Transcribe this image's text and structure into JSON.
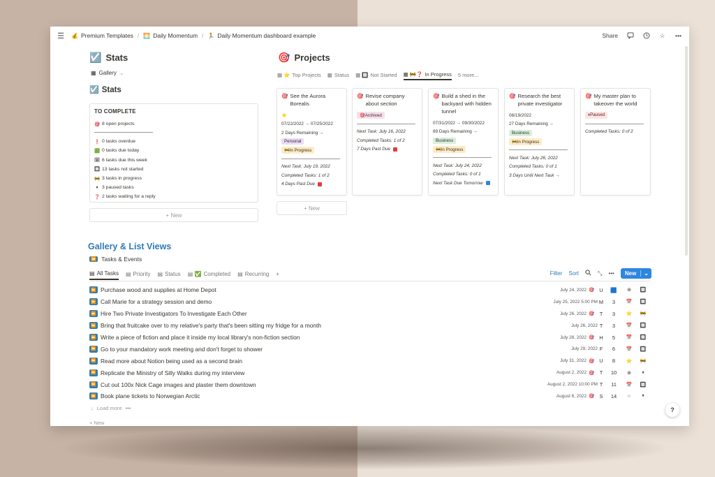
{
  "topbar": {
    "breadcrumbs": [
      {
        "icon": "💰",
        "label": "Premium Templates"
      },
      {
        "icon": "🌅",
        "label": "Daily Momentum"
      },
      {
        "icon": "🏃",
        "label": "Daily Momentum dashboard example"
      }
    ],
    "share_label": "Share"
  },
  "stats": {
    "title": "Stats",
    "view_label": "Gallery",
    "subtitle": "Stats",
    "box_title": "TO COMPLETE",
    "open_projects": "8 open projects",
    "lines": [
      {
        "icon": "❗",
        "text": "0 tasks overdue"
      },
      {
        "icon": "🟩",
        "text": "0 tasks due today"
      },
      {
        "icon": "🗓",
        "text": "6 tasks due this week"
      },
      {
        "icon": "🔲",
        "text": "13 tasks not started"
      },
      {
        "icon": "🚧",
        "text": "3 tasks in progress"
      },
      {
        "icon": "⏸",
        "text": "3 paused tasks"
      },
      {
        "icon": "❓",
        "text": "2 tasks waiting for a reply"
      }
    ],
    "new_label": "New"
  },
  "projects": {
    "title": "Projects",
    "tabs": [
      {
        "icon": "⭐",
        "label": "Top Projects"
      },
      {
        "icon": "▦",
        "label": "Status"
      },
      {
        "icon": "▦",
        "label": "Not Started"
      },
      {
        "icon": "❓",
        "label": "In Progress"
      }
    ],
    "more_label": "5 more...",
    "new_label": "New",
    "cards": [
      {
        "title": "See the Aurora Borealis",
        "star": "⭐",
        "dates": "07/22/2022 → 07/25/2022",
        "remaining": "2 Days Remaining →",
        "tag1": "Personal",
        "tag2": "🚧In Progress",
        "next_task": "Next Task: July 19, 2022",
        "completed": "Completed Tasks: 1 of 2",
        "due": "4 Days Past Due"
      },
      {
        "title": "Revise company about section",
        "tag_archived": "🎯Archived",
        "next_task": "Next Task: July 16, 2022",
        "completed": "Completed Tasks: 1 of 2",
        "due": "7 Days Past Due"
      },
      {
        "title": "Build a shed in the backyard with hidden tunnel",
        "dates": "07/31/2022 → 09/30/2022",
        "remaining": "69 Days Remaining →",
        "tag1": "Business",
        "tag2": "🚧In Progress",
        "next_task": "Next Task: July 24, 2022",
        "completed": "Completed Tasks: 0 of 1",
        "due": "Next Task Due Tomorrow"
      },
      {
        "title": "Research the best private investigator",
        "dates": "08/19/2022",
        "remaining": "27 Days Remaining →",
        "tag1": "Business",
        "tag2": "🚧In Progress",
        "next_task": "Next Task: July 26, 2022",
        "completed": "Completed Tasks: 0 of 1",
        "due": "3 Days Until Next Task →"
      },
      {
        "title": "My master plan to takeover the world",
        "tag_paused": "⏸Paused",
        "completed": "Completed Tasks: 0 of 2"
      }
    ]
  },
  "gallery": {
    "title": "Gallery & List Views",
    "subtitle": "Tasks & Events",
    "tabs": [
      "All Tasks",
      "Priority",
      "Status",
      "Completed",
      "Recurring"
    ],
    "filter_label": "Filter",
    "sort_label": "Sort",
    "new_label": "New",
    "load_more": "Load more",
    "new_row_label": "New",
    "rows": [
      {
        "name": "Purchase wood and supplies at Home Depot",
        "date": "July 24, 2022",
        "tag": "🎯",
        "c1": "U",
        "c2": "🟦",
        "c3": "⊛",
        "c4": "🔲"
      },
      {
        "name": "Call Marie for a strategy session and demo",
        "date": "July 25, 2022 5:00 PM",
        "tag": "",
        "c1": "M",
        "c2": "3",
        "c3": "📅",
        "c4": "🔲"
      },
      {
        "name": "Hire Two Private Investigators To Investigate Each Other",
        "date": "July 26, 2022",
        "tag": "🎯",
        "c1": "T",
        "c2": "3",
        "c3": "⭐",
        "c4": "🚧"
      },
      {
        "name": "Bring that fruitcake over to my relative's party that's been sitting my fridge for a month",
        "date": "July 26, 2022",
        "tag": "",
        "c1": "T",
        "c2": "3",
        "c3": "📅",
        "c4": "🔲"
      },
      {
        "name": "Write a piece of fiction and place it inside my local library's non-fiction section",
        "date": "July 28, 2022",
        "tag": "🎯",
        "c1": "H",
        "c2": "5",
        "c3": "📅",
        "c4": "🔲"
      },
      {
        "name": "Go to your mandatory work meeting and don't forget to shower",
        "date": "July 29, 2022",
        "tag": "",
        "c1": "F",
        "c2": "6",
        "c3": "📅",
        "c4": "🔲"
      },
      {
        "name": "Read more about Notion being used as a second brain",
        "date": "July 31, 2022",
        "tag": "🎯",
        "c1": "U",
        "c2": "8",
        "c3": "⭐",
        "c4": "🚧"
      },
      {
        "name": "Replicate the Ministry of Silly Walks during my interview",
        "date": "August 2, 2022",
        "tag": "🎯",
        "c1": "T",
        "c2": "10",
        "c3": "⊛",
        "c4": "⏸"
      },
      {
        "name": "Cut out 100x Nick Cage images and plaster them downtown",
        "date": "August 2, 2022 10:00 PM",
        "tag": "",
        "c1": "T",
        "c2": "11",
        "c3": "📅",
        "c4": "🔲"
      },
      {
        "name": "Book plane tickets to Norwegian Arctic",
        "date": "August 6, 2022",
        "tag": "🎯",
        "c1": "S",
        "c2": "14",
        "c3": "○",
        "c4": "⏸"
      }
    ]
  },
  "help_label": "?"
}
